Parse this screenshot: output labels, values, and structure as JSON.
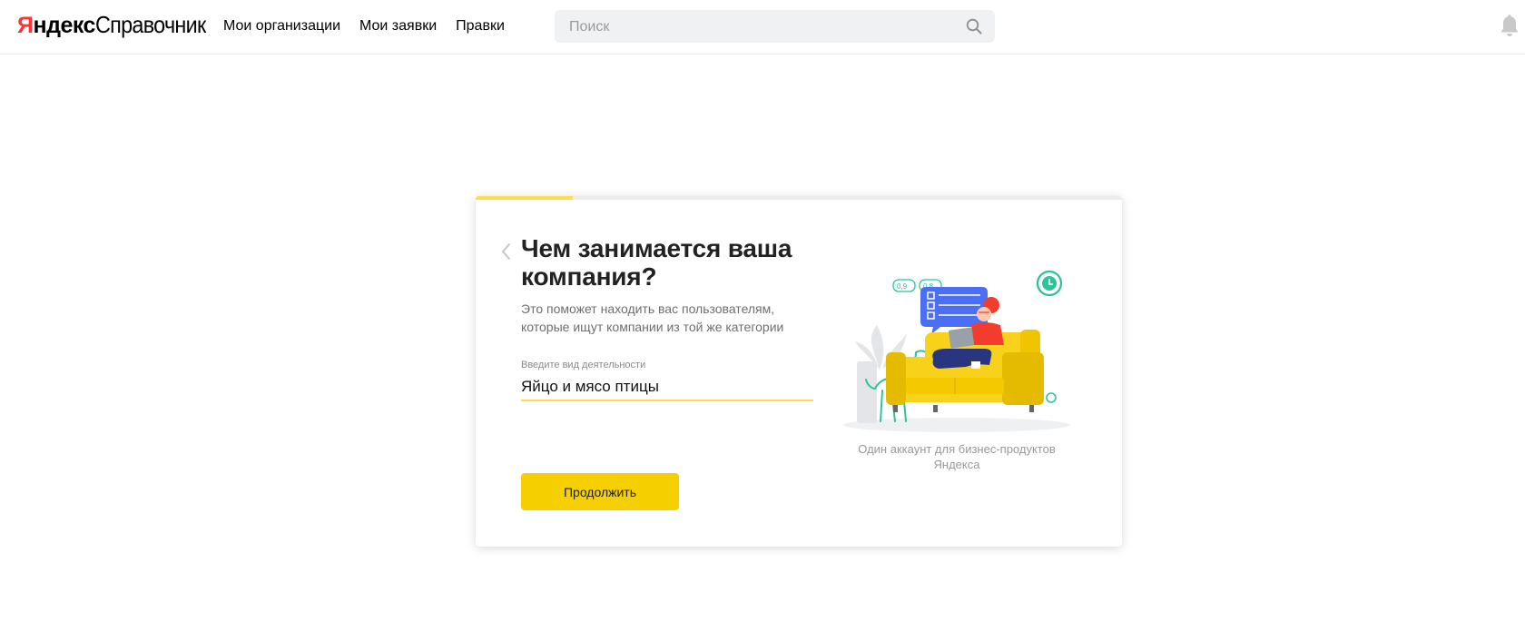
{
  "header": {
    "logo_part1_red": "Я",
    "logo_part1_rest": "ндекс",
    "logo_part2": "Справочник",
    "nav": [
      {
        "label": "Мои организации"
      },
      {
        "label": "Мои заявки"
      },
      {
        "label": "Правки"
      }
    ],
    "search": {
      "placeholder": "Поиск",
      "value": ""
    },
    "icons": {
      "search": "search-icon",
      "bell": "bell-icon"
    }
  },
  "card": {
    "progress_fraction": 0.15,
    "title": "Чем занимается ваша компания?",
    "subtitle": "Это поможет находить вас пользователям, которые ищут компании из той же категории",
    "field": {
      "label": "Введите вид деятельности",
      "value": "Яйцо и мясо птицы"
    },
    "continue_label": "Продолжить",
    "illustration": {
      "badge_1": "0,9",
      "badge_2": "0,8"
    },
    "caption": "Один аккаунт для бизнес-продуктов Яндекса"
  },
  "colors": {
    "accent_yellow": "#f5cf00",
    "progress_yellow": "#ffdb4d",
    "logo_red": "#ff3333",
    "sofa_yellow": "#f7d11a",
    "illustration_green": "#2fc39a",
    "illustration_blue": "#4c6ef5"
  }
}
